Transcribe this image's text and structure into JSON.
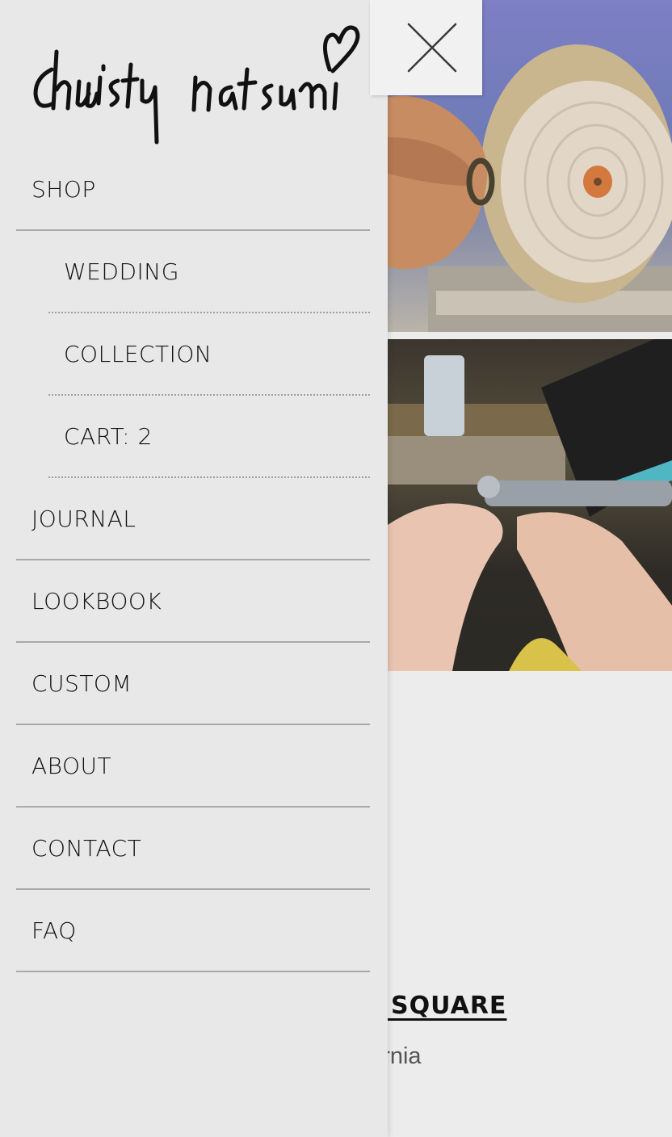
{
  "brand": {
    "logo_text": "christy natsumi"
  },
  "menu": {
    "items": [
      {
        "label": "SHOP",
        "level": 0
      },
      {
        "label": "WEDDING",
        "level": 1
      },
      {
        "label": "COLLECTION",
        "level": 1
      },
      {
        "label": "CART: 2",
        "level": 1
      },
      {
        "label": "JOURNAL",
        "level": 0
      },
      {
        "label": "LOOKBOOK",
        "level": 0
      },
      {
        "label": "CUSTOM",
        "level": 0
      },
      {
        "label": "ABOUT",
        "level": 0
      },
      {
        "label": "CONTACT",
        "level": 0
      },
      {
        "label": "FAQ",
        "level": 0
      }
    ]
  },
  "close": {
    "icon": "close-icon"
  },
  "background": {
    "partial_colon": ":",
    "partial_link": "ON SQUARE",
    "partial_city": "alifornia"
  },
  "colors": {
    "drawer_bg": "#e8e8e8",
    "page_bg": "#ececec",
    "divider": "#a8a8a8",
    "text": "#111111"
  }
}
